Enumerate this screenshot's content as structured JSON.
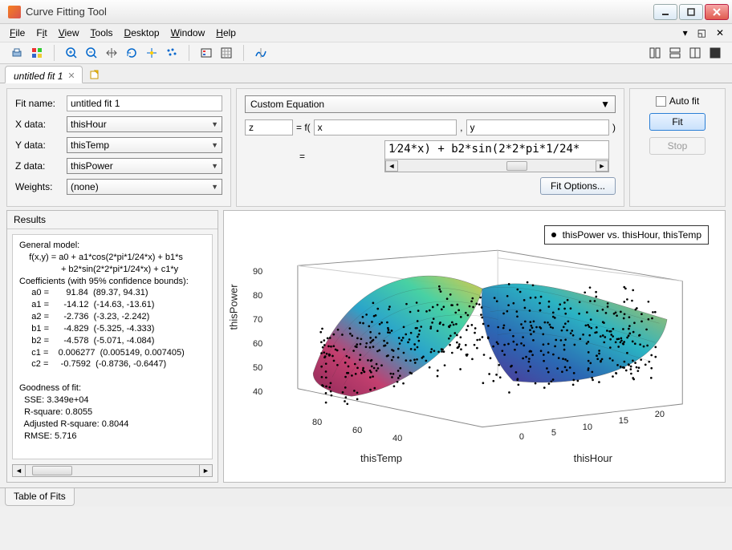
{
  "window": {
    "title": "Curve Fitting Tool"
  },
  "menu": {
    "file": "File",
    "fit": "Fit",
    "view": "View",
    "tools": "Tools",
    "desktop": "Desktop",
    "window": "Window",
    "help": "Help"
  },
  "doc_tab": {
    "label": "untitled fit 1"
  },
  "form": {
    "fit_name_label": "Fit name:",
    "fit_name_value": "untitled fit 1",
    "x_label": "X data:",
    "x_value": "thisHour",
    "y_label": "Y data:",
    "y_value": "thisTemp",
    "z_label": "Z data:",
    "z_value": "thisPower",
    "w_label": "Weights:",
    "w_value": "(none)"
  },
  "equation": {
    "type": "Custom Equation",
    "lhs": "z",
    "eq": "= f(",
    "xarg": "x",
    "comma": ",",
    "yarg": "y",
    "rparen": ")",
    "rhs_prefix": "= ",
    "rhs_text": "1⁄24*x) + b2*sin(2*2*pi*1/24*",
    "fit_options": "Fit Options..."
  },
  "right": {
    "auto_fit": "Auto fit",
    "fit": "Fit",
    "stop": "Stop"
  },
  "results": {
    "header": "Results",
    "body": "General model:\n    f(x,y) = a0 + a1*cos(2*pi*1/24*x) + b1*s\n                 + b2*sin(2*2*pi*1/24*x) + c1*y\nCoefficients (with 95% confidence bounds):\n     a0 =       91.84  (89.37, 94.31)\n     a1 =      -14.12  (-14.63, -13.61)\n     a2 =      -2.736  (-3.23, -2.242)\n     b1 =      -4.829  (-5.325, -4.333)\n     b2 =      -4.578  (-5.071, -4.084)\n     c1 =    0.006277  (0.005149, 0.007405)\n     c2 =     -0.7592  (-0.8736, -0.6447)\n\nGoodness of fit:\n  SSE: 3.349e+04\n  R-square: 0.8055\n  Adjusted R-square: 0.8044\n  RMSE: 5.716"
  },
  "plot": {
    "legend": "thisPower vs. thisHour, thisTemp",
    "z_label": "thisPower",
    "x_label": "thisHour",
    "y_label": "thisTemp",
    "z_ticks": [
      "40",
      "50",
      "60",
      "70",
      "80",
      "90"
    ],
    "x_ticks": [
      "0",
      "5",
      "10",
      "15",
      "20"
    ],
    "y_ticks": [
      "80",
      "60",
      "40"
    ]
  },
  "chart_data": {
    "type": "surface3d_with_scatter",
    "title": "",
    "x_axis": {
      "label": "thisHour",
      "range": [
        0,
        23
      ]
    },
    "y_axis": {
      "label": "thisTemp",
      "range": [
        30,
        90
      ]
    },
    "z_axis": {
      "label": "thisPower",
      "range": [
        35,
        95
      ]
    },
    "surface_model": "z = 91.84 - 14.12*cos(2*pi/24*x) - 4.829*sin(2*pi/24*x) - 2.736*cos(4*pi/24*x) - 4.578*sin(4*pi/24*x) + 0.006277*y - 0.7592*y",
    "scatter_series": {
      "name": "thisPower vs. thisHour, thisTemp",
      "approx_n_points": 900,
      "z_range": [
        35,
        95
      ]
    }
  },
  "bottom_tab": "Table of Fits"
}
